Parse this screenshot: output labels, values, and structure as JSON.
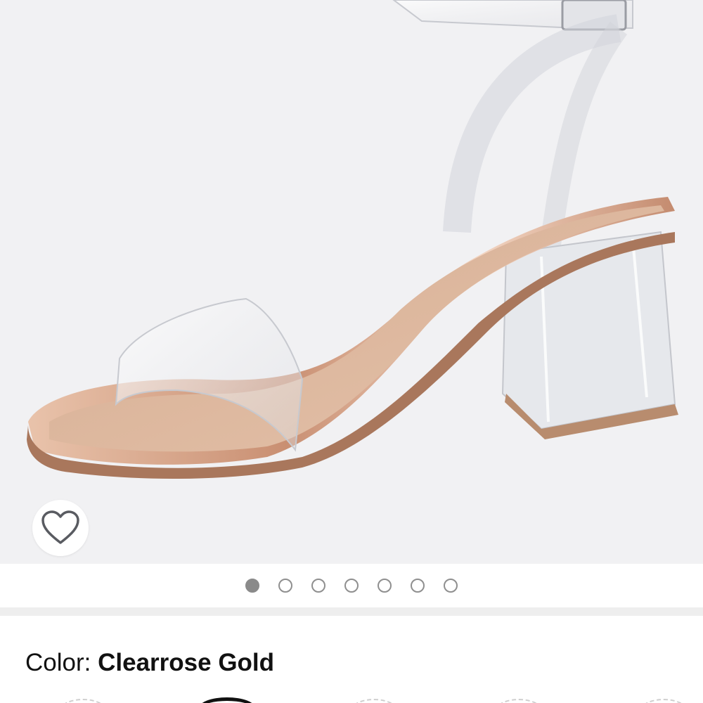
{
  "gallery": {
    "image_alt": "Clear strap block heel sandal",
    "image_count": 7,
    "active_index": 0,
    "wishlist_icon": "heart-outline-icon"
  },
  "color": {
    "label": "Color:",
    "value": "Clearrose Gold"
  },
  "swatches": {
    "count": 5,
    "selected_index": 1
  },
  "colors": {
    "background": "#f1f1f3",
    "dot_active": "#8a8a8a",
    "text": "#111111",
    "rose_gold": "#d9ae94"
  }
}
